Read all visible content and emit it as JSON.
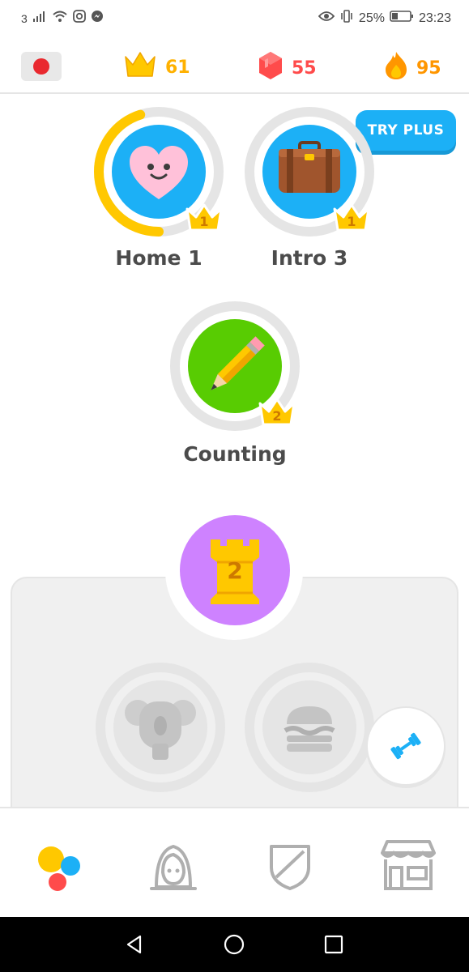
{
  "status_bar": {
    "carrier": "3",
    "battery": "25%",
    "time": "23:23"
  },
  "stats": {
    "crowns": "61",
    "gems": "55",
    "streak": "95"
  },
  "colors": {
    "crown": "#ffc800",
    "gems": "#ff4b4b",
    "streak": "#ff9600",
    "skill_blue": "#1cb0f6",
    "skill_green": "#58cc02",
    "checkpoint_purple": "#ce82ff",
    "progress_gold": "#ffc800"
  },
  "promo": {
    "try_plus": "TRY PLUS"
  },
  "skills": [
    {
      "label": "Home 1",
      "crown_level": "1",
      "icon": "heart-icon",
      "progress": 0.45
    },
    {
      "label": "Intro 3",
      "crown_level": "1",
      "icon": "suitcase-icon",
      "progress": 0
    },
    {
      "label": "Counting",
      "crown_level": "2",
      "icon": "pencil-icon",
      "progress": 0
    }
  ],
  "checkpoint": {
    "number": "2",
    "icon": "castle-icon"
  },
  "locked_skills": [
    {
      "icon": "koala-icon"
    },
    {
      "icon": "burger-icon"
    }
  ],
  "practice": {
    "icon": "dumbbell-icon"
  },
  "bottom_nav": [
    {
      "icon": "learn-icon"
    },
    {
      "icon": "profile-icon"
    },
    {
      "icon": "leaderboard-shield-icon"
    },
    {
      "icon": "shop-icon"
    }
  ]
}
